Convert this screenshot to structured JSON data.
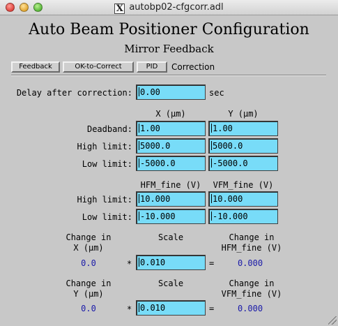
{
  "window": {
    "title": "autobp02-cfgcorr.adl"
  },
  "heading": {
    "title": "Auto Beam Positioner Configuration",
    "subtitle": "Mirror Feedback"
  },
  "nav": {
    "feedback_label": "Feedback",
    "ok_to_correct_label": "OK-to-Correct",
    "pid_label": "PID",
    "current_label": "Correction"
  },
  "delay": {
    "label": "Delay after correction:",
    "value": "0.00",
    "unit": "sec"
  },
  "position_limits": {
    "col_x": "X (µm)",
    "col_y": "Y (µm)",
    "deadband_label": "Deadband:",
    "deadband_x": "1.00",
    "deadband_y": "1.00",
    "high_label": "High limit:",
    "high_x": "5000.0",
    "high_y": "5000.0",
    "low_label": "Low limit:",
    "low_x": "-5000.0",
    "low_y": "-5000.0"
  },
  "fine_limits": {
    "col_hfm": "HFM_fine (V)",
    "col_vfm": "VFM_fine (V)",
    "high_label": "High limit:",
    "high_hfm": "10.000",
    "high_vfm": "10.000",
    "low_label": "Low limit:",
    "low_hfm": "-10.000",
    "low_vfm": "-10.000"
  },
  "scale_x": {
    "change_label_1": "Change in",
    "change_label_2": "X (µm)",
    "change_value": "0.0",
    "scale_label": "Scale",
    "op_mult": "*",
    "scale_value": "0.010",
    "op_eq": "=",
    "result_label_1": "Change in",
    "result_label_2": "HFM_fine (V)",
    "result_value": "0.000"
  },
  "scale_y": {
    "change_label_1": "Change in",
    "change_label_2": "Y (µm)",
    "change_value": "0.0",
    "scale_label": "Scale",
    "op_mult": "*",
    "scale_value": "0.010",
    "op_eq": "=",
    "result_label_1": "Change in",
    "result_label_2": "VFM_fine (V)",
    "result_value": "0.000"
  },
  "colors": {
    "background": "#c8c8c8",
    "field": "#78dcf8",
    "readback": "#1a1aa8"
  }
}
